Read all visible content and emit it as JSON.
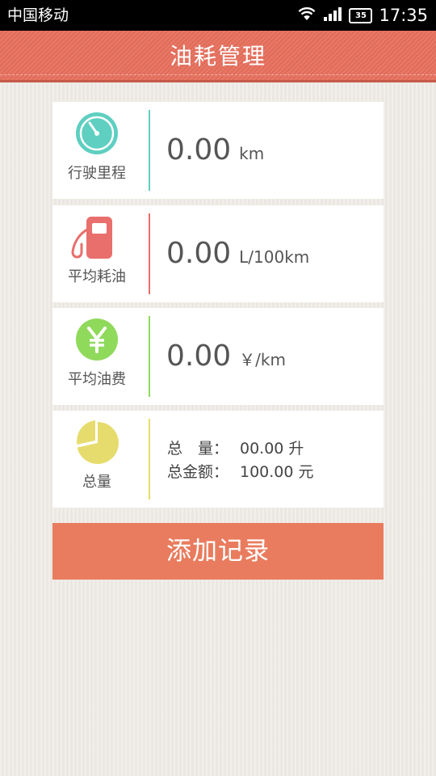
{
  "status_bar": {
    "carrier": "中国移动",
    "battery": "35",
    "time": "17:35"
  },
  "header": {
    "title": "油耗管理"
  },
  "cards": [
    {
      "label": "行驶里程",
      "value": "0.00",
      "unit": "km",
      "icon": "speedometer-icon",
      "color": "#5ecfc0"
    },
    {
      "label": "平均耗油",
      "value": "0.00",
      "unit": "L/100km",
      "icon": "fuel-pump-icon",
      "color": "#e86f6c"
    },
    {
      "label": "平均油费",
      "value": "0.00",
      "unit": "￥/km",
      "icon": "yen-coin-icon",
      "color": "#8fd95b"
    },
    {
      "label": "总量",
      "icon": "pie-chart-icon",
      "color": "#e6dc6e"
    }
  ],
  "totals": {
    "amount_label": "总　量：",
    "amount_value": "00.00 升",
    "money_label": "总金额：",
    "money_value": "100.00 元"
  },
  "add_button": {
    "label": "添加记录",
    "color": "#e97c5e"
  }
}
